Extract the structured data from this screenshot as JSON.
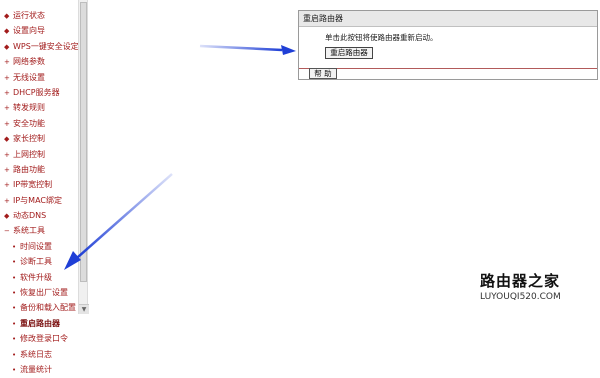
{
  "sidebar": {
    "items": [
      {
        "label": "运行状态",
        "bullet": "◆",
        "sub": false
      },
      {
        "label": "设置向导",
        "bullet": "◆",
        "sub": false
      },
      {
        "label": "WPS一键安全设定",
        "bullet": "◆",
        "sub": false
      },
      {
        "label": "网络参数",
        "bullet": "+",
        "sub": false
      },
      {
        "label": "无线设置",
        "bullet": "+",
        "sub": false
      },
      {
        "label": "DHCP服务器",
        "bullet": "+",
        "sub": false
      },
      {
        "label": "转发规则",
        "bullet": "+",
        "sub": false
      },
      {
        "label": "安全功能",
        "bullet": "+",
        "sub": false
      },
      {
        "label": "家长控制",
        "bullet": "◆",
        "sub": false
      },
      {
        "label": "上网控制",
        "bullet": "+",
        "sub": false
      },
      {
        "label": "路由功能",
        "bullet": "+",
        "sub": false
      },
      {
        "label": "IP带宽控制",
        "bullet": "+",
        "sub": false
      },
      {
        "label": "IP与MAC绑定",
        "bullet": "+",
        "sub": false
      },
      {
        "label": "动态DNS",
        "bullet": "◆",
        "sub": false
      },
      {
        "label": "系统工具",
        "bullet": "−",
        "sub": false
      },
      {
        "label": "时间设置",
        "bullet": "•",
        "sub": true
      },
      {
        "label": "诊断工具",
        "bullet": "•",
        "sub": true
      },
      {
        "label": "软件升级",
        "bullet": "•",
        "sub": true
      },
      {
        "label": "恢复出厂设置",
        "bullet": "•",
        "sub": true
      },
      {
        "label": "备份和载入配置",
        "bullet": "•",
        "sub": true
      },
      {
        "label": "重启路由器",
        "bullet": "•",
        "sub": true
      },
      {
        "label": "修改登录口令",
        "bullet": "•",
        "sub": true
      },
      {
        "label": "系统日志",
        "bullet": "•",
        "sub": true
      },
      {
        "label": "流量统计",
        "bullet": "•",
        "sub": true
      }
    ]
  },
  "panel": {
    "title": "重启路由器",
    "instruction": "单击此按钮将使路由器重新启动。",
    "reboot_button": "重启路由器",
    "help_button": "帮 助"
  },
  "watermark": {
    "title": "路由器之家",
    "url": "LUYOUQI520.COM"
  },
  "colors": {
    "menu_text": "#a21c1c",
    "arrow": "#1f3fd6",
    "panel_header": "#e8e8e8"
  }
}
